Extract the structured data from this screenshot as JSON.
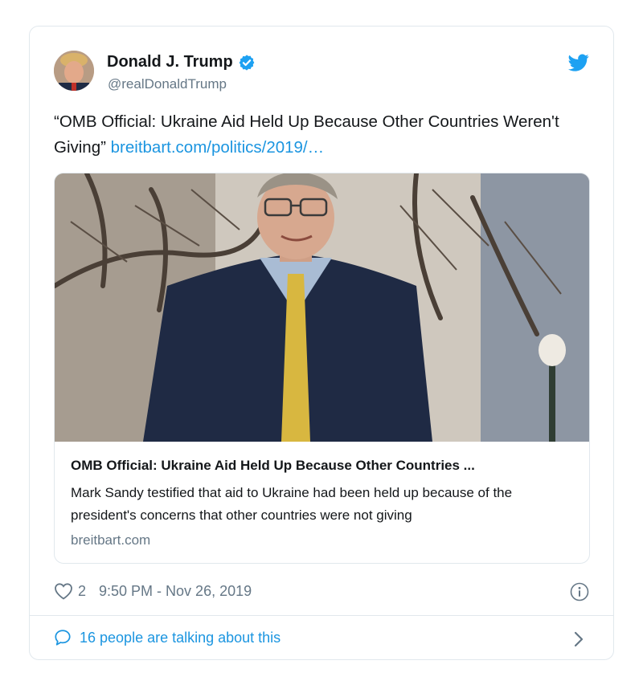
{
  "tweet": {
    "author_name": "Donald J. Trump",
    "author_handle": "@realDonaldTrump",
    "text_before_link": "“OMB Official: Ukraine Aid Held Up Because Other Countries Weren't Giving” ",
    "link_text": "breitbart.com/politics/2019/…",
    "likes": "2",
    "timestamp": "9:50 PM - Nov 26, 2019",
    "talking_text": "16 people are talking about this"
  },
  "link_card": {
    "title": "OMB Official: Ukraine Aid Held Up Because Other Countries ...",
    "description": "Mark Sandy testified that aid to Ukraine had been held up because of the president's concerns that other countries were not giving",
    "domain": "breitbart.com"
  },
  "icons": {
    "verified": "verified-badge-icon",
    "bird": "twitter-bird-icon",
    "like": "heart-icon",
    "info": "info-icon",
    "reply": "speech-bubble-icon",
    "chevron": "chevron-right-icon"
  },
  "colors": {
    "accent": "#1b95e0",
    "verified": "#1da1f2",
    "muted": "#657786",
    "border": "#e1e8ed"
  }
}
